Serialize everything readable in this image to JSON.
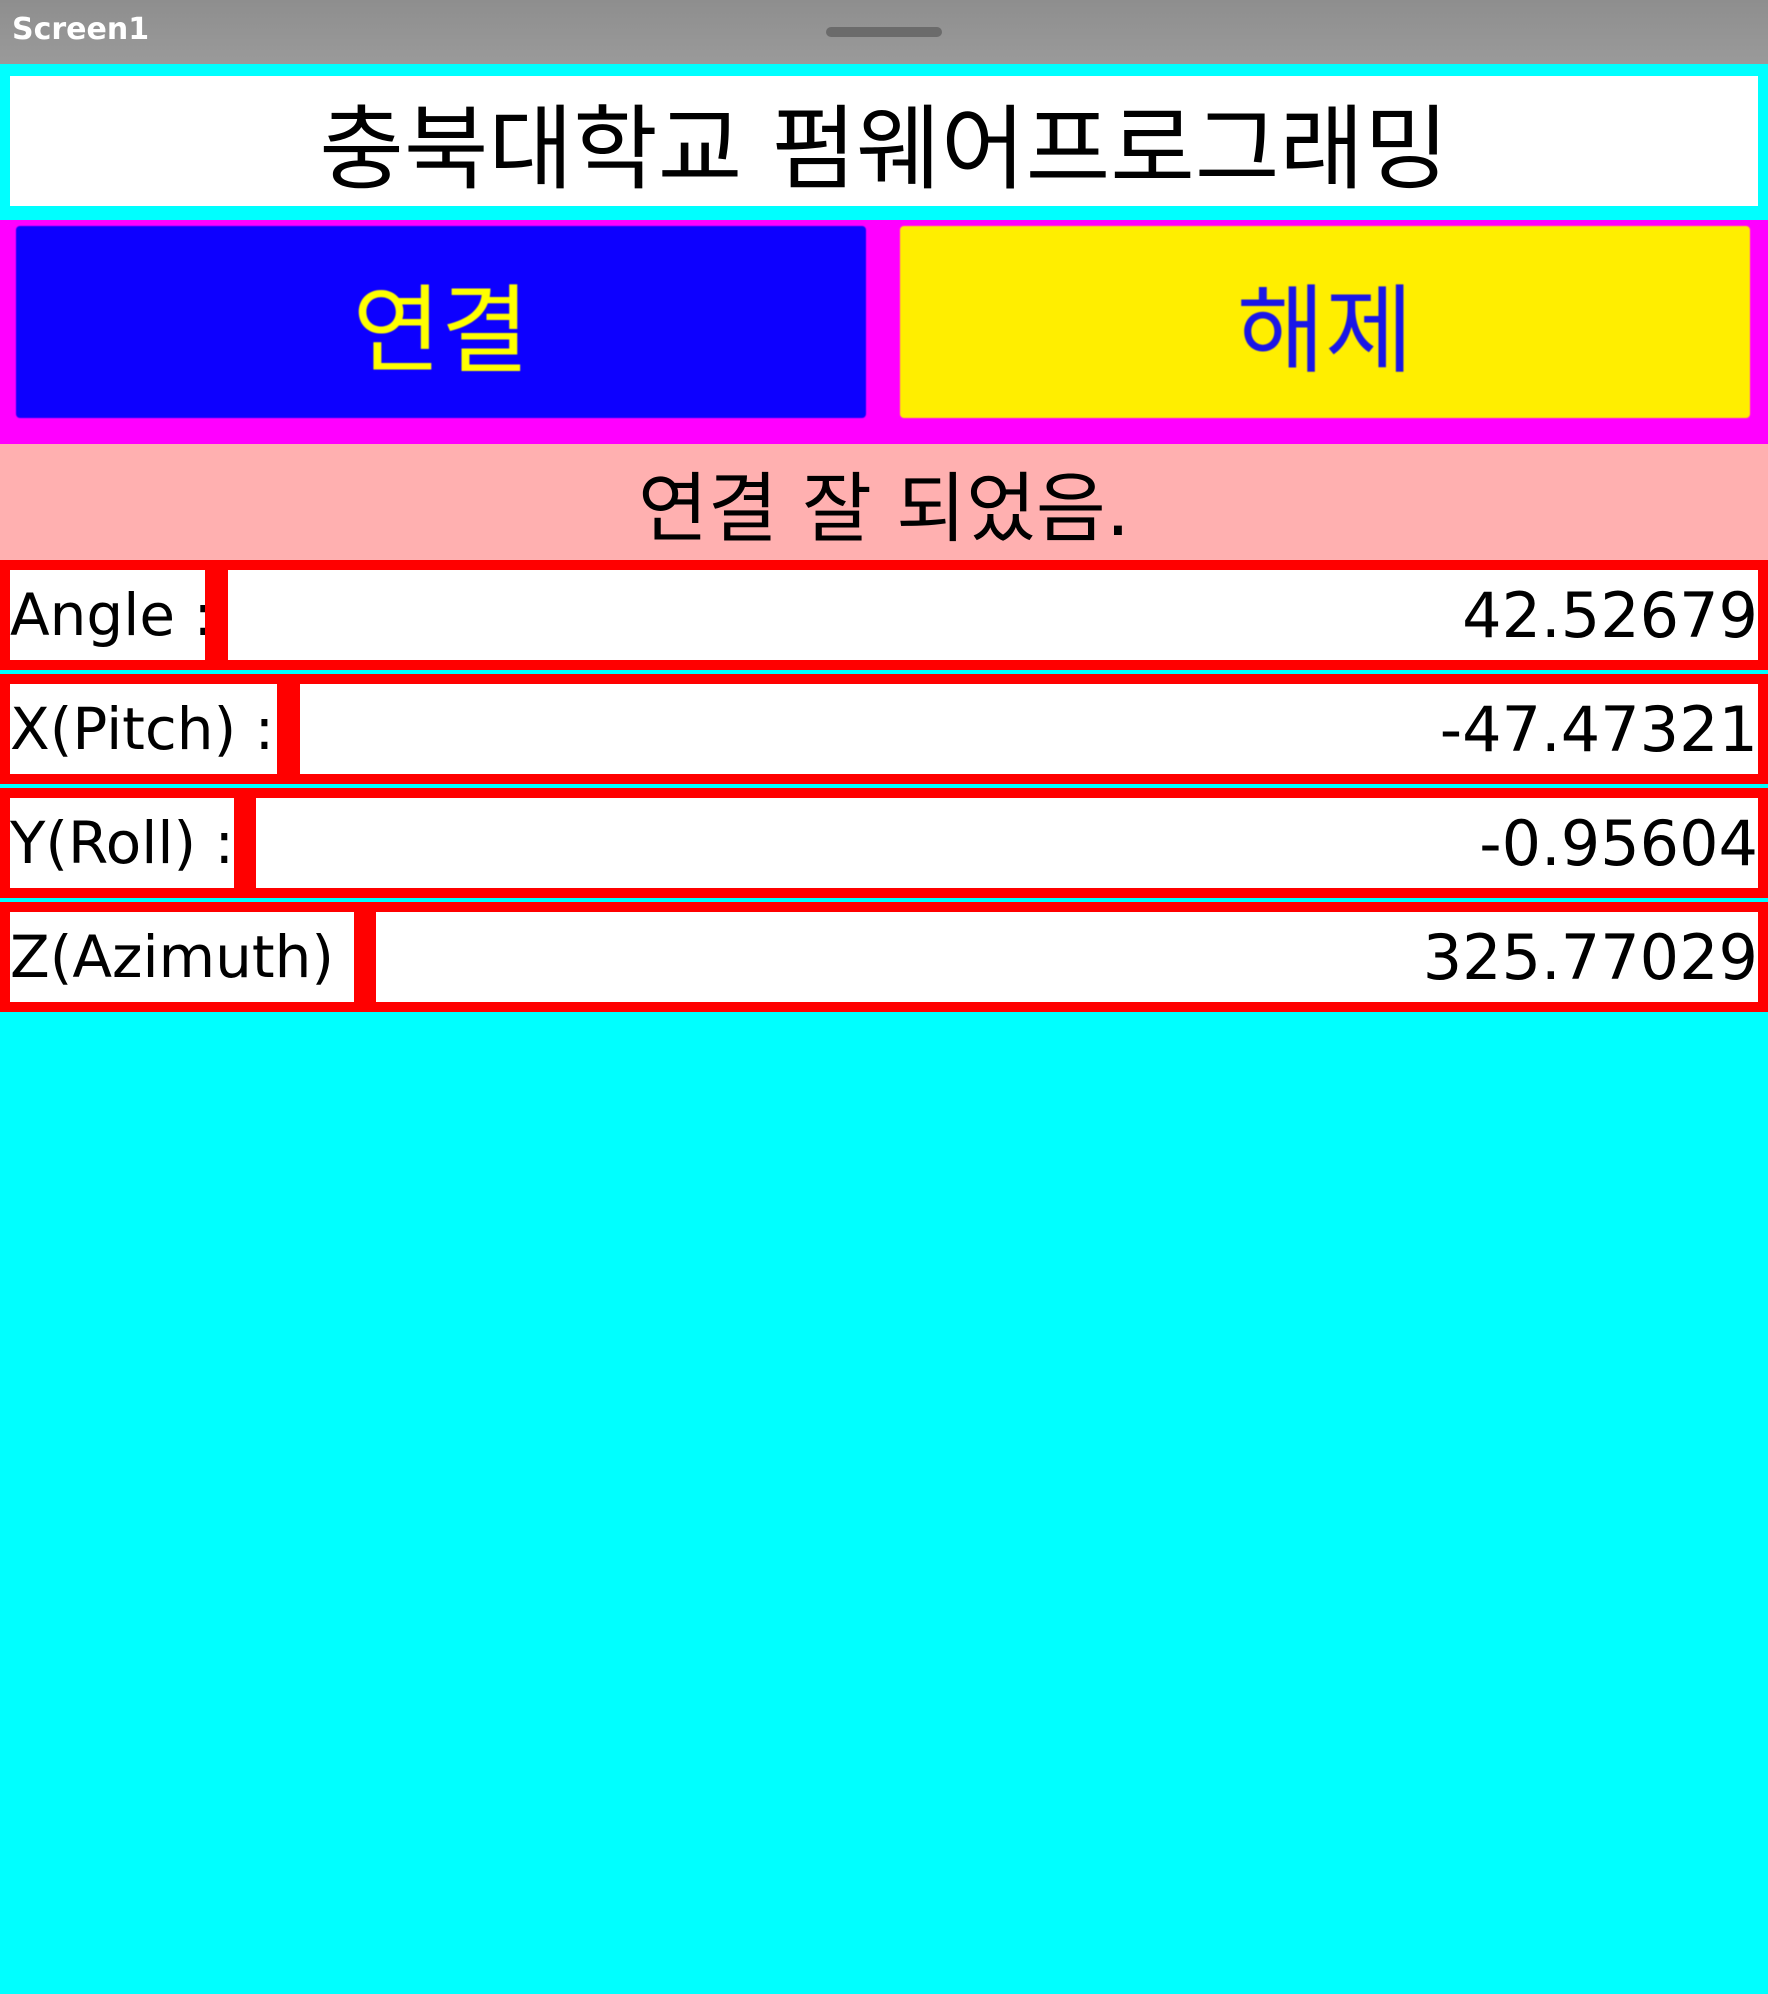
{
  "window": {
    "screen_name": "Screen1"
  },
  "header": {
    "title": "충북대학교 펌웨어프로그래밍"
  },
  "buttons": {
    "connect_label": "연결",
    "disconnect_label": "해제"
  },
  "status": {
    "text": "연결 잘 되었음."
  },
  "sensors": {
    "angle": {
      "label": "Angle :",
      "value": "42.52679"
    },
    "pitch": {
      "label": "X(Pitch) :",
      "value": "-47.47321"
    },
    "roll": {
      "label": "Y(Roll) :",
      "value": "-0.95604"
    },
    "azimuth": {
      "label": "Z(Azimuth) :",
      "value": "325.77029"
    }
  },
  "colors": {
    "background": "#00ffff",
    "button_row": "#ff00ff",
    "connect_button": "#0d00ff",
    "connect_text": "#ffff00",
    "disconnect_button": "#ffee00",
    "disconnect_text": "#1a16e6",
    "status_bar": "#ffb0b0",
    "sensor_border": "#ff0000"
  }
}
